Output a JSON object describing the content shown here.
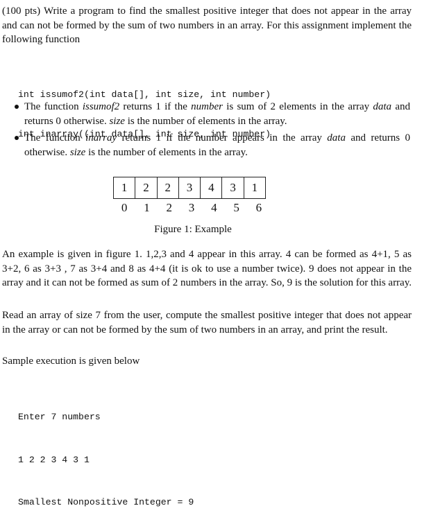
{
  "intro": "(100 pts) Write a program to find the smallest positive integer that does not appear in the array and can not be formed by the sum of two numbers in an array. For this assignment implement the following function",
  "signatures": [
    "int issumof2(int data[], int size, int number)",
    "int inarray((int data[], int size, int number)"
  ],
  "bullets": [
    {
      "parts": [
        {
          "t": "The function ",
          "i": false
        },
        {
          "t": "issumof2",
          "i": true
        },
        {
          "t": " returns 1 if the ",
          "i": false
        },
        {
          "t": "number",
          "i": true
        },
        {
          "t": " is sum of 2 elements in the array ",
          "i": false
        },
        {
          "t": "data",
          "i": true
        },
        {
          "t": " and returns 0 otherwise. ",
          "i": false
        },
        {
          "t": "size",
          "i": true
        },
        {
          "t": " is the number of elements in the array.",
          "i": false
        }
      ]
    },
    {
      "parts": [
        {
          "t": "The function ",
          "i": false
        },
        {
          "t": "inarray",
          "i": true
        },
        {
          "t": " returns 1 if the number appears in the array ",
          "i": false
        },
        {
          "t": "data",
          "i": true
        },
        {
          "t": " and returns 0 otherwise. ",
          "i": false
        },
        {
          "t": "size",
          "i": true
        },
        {
          "t": " is the number of elements in the array.",
          "i": false
        }
      ]
    }
  ],
  "figure": {
    "values": [
      "1",
      "2",
      "2",
      "3",
      "4",
      "3",
      "1"
    ],
    "indices": [
      "0",
      "1",
      "2",
      "3",
      "4",
      "5",
      "6"
    ],
    "caption": "Figure 1: Example"
  },
  "example_paragraph": "An example is given in figure 1. 1,2,3 and 4 appear in this array. 4 can be formed as 4+1, 5 as 3+2, 6 as 3+3 , 7 as 3+4 and 8 as 4+4 (it is ok to use a number twice). 9 does not appear in the array and it can not be formed as sum of 2 numbers in the array. So, 9 is the solution for this array.",
  "task_paragraph": "Read an array of size 7 from the user, compute the smallest positive integer that does not appear in the array or can not be formed by the sum of two numbers in an array, and print the result.",
  "sample_label": "Sample execution is given below",
  "sample_output": [
    "Enter 7 numbers",
    "1 2 2 3 4 3 1",
    "Smallest Nonpositive Integer = 9"
  ]
}
